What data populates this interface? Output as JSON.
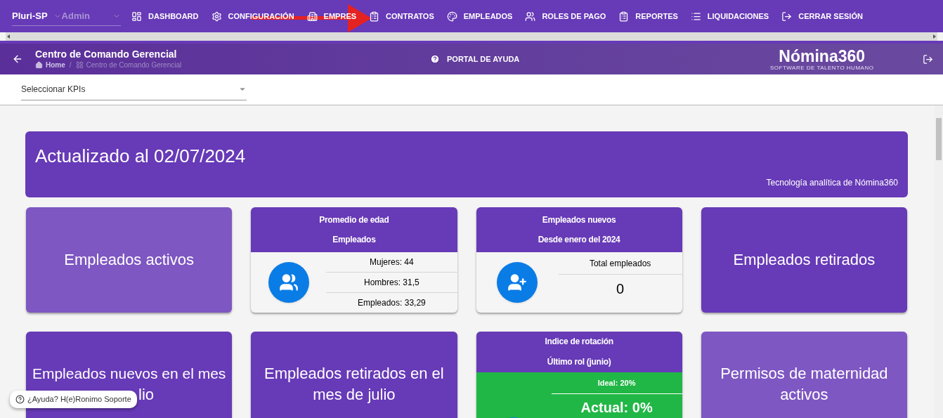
{
  "top_nav": {
    "company": "Pluri-SP",
    "role": "Admin",
    "items": [
      {
        "label": "DASHBOARD"
      },
      {
        "label": "CONFIGURACIÓN"
      },
      {
        "label": "EMPRES"
      },
      {
        "label": "CONTRATOS"
      },
      {
        "label": "EMPLEADOS"
      },
      {
        "label": "ROLES DE PAGO"
      },
      {
        "label": "REPORTES"
      },
      {
        "label": "LIQUIDACIONES"
      },
      {
        "label": "CERRAR SESIÓN"
      }
    ]
  },
  "header": {
    "title": "Centro de Comando Gerencial",
    "breadcrumb": [
      "Home",
      "Centro de Comando Gerencial"
    ],
    "breadcrumb_separator": "/",
    "help_link": "PORTAL DE AYUDA",
    "logo": {
      "name": "Nómina360",
      "tagline": "SOFTWARE DE TALENTO HUMANO"
    }
  },
  "kpi_select": {
    "placeholder": "Seleccionar KPIs"
  },
  "banner": {
    "title": "Actualizado al 02/07/2024",
    "subtitle": "Tecnología analítica de Nómina360"
  },
  "cards": [
    {
      "kind": "title",
      "color": "#7e57c2",
      "title": "Empleados activos"
    },
    {
      "kind": "stats",
      "header": [
        "Promedio de edad",
        "Empleados"
      ],
      "rows": [
        "Mujeres: 44",
        "Hombres: 31,5",
        "Empleados: 33,29"
      ]
    },
    {
      "kind": "total",
      "header": [
        "Empleados nuevos",
        "Desde enero del 2024"
      ],
      "label": "Total empleados",
      "value": "0"
    },
    {
      "kind": "title",
      "color": "#673ab7",
      "title": "Empleados retirados"
    },
    {
      "kind": "title",
      "color": "#673ab7",
      "title": "Empleados nuevos en el mes",
      "title_tail": "lio"
    },
    {
      "kind": "title",
      "color": "#673ab7",
      "title": "Empleados retirados en el mes de julio"
    },
    {
      "kind": "rotation",
      "header": [
        "Indice de rotación",
        "Último rol (junio)"
      ],
      "ideal": "Ideal: 20%",
      "actual": "Actual: 0%"
    },
    {
      "kind": "title",
      "color": "#7e57c2",
      "title": "Permisos de maternidad activos"
    }
  ],
  "help_chip": "¿Ayuda? H(e)Ronimo Soporte"
}
